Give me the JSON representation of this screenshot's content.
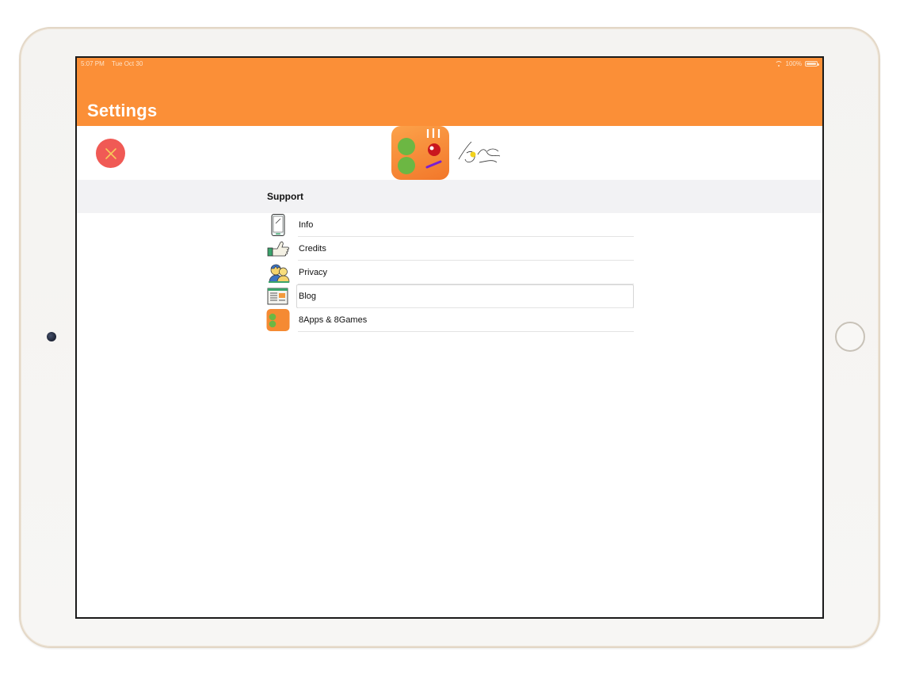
{
  "status_bar": {
    "time": "5:07 PM",
    "date": "Tue Oct 30",
    "battery": "100%"
  },
  "nav": {
    "title": "Settings",
    "bar_color": "#fb8f37"
  },
  "header": {
    "close_icon": "close-icon",
    "close_color": "#f05a55",
    "logo_icon": "app-logo-icon",
    "signature_icon": "signature-icon"
  },
  "support": {
    "section_title": "Support",
    "items": [
      {
        "label": "Info",
        "icon": "phone-icon"
      },
      {
        "label": "Credits",
        "icon": "thumbs-up-icon"
      },
      {
        "label": "Privacy",
        "icon": "people-icon"
      },
      {
        "label": "Blog",
        "icon": "newspaper-icon",
        "selected": true
      },
      {
        "label": "8Apps & 8Games",
        "icon": "app-icon"
      }
    ]
  }
}
